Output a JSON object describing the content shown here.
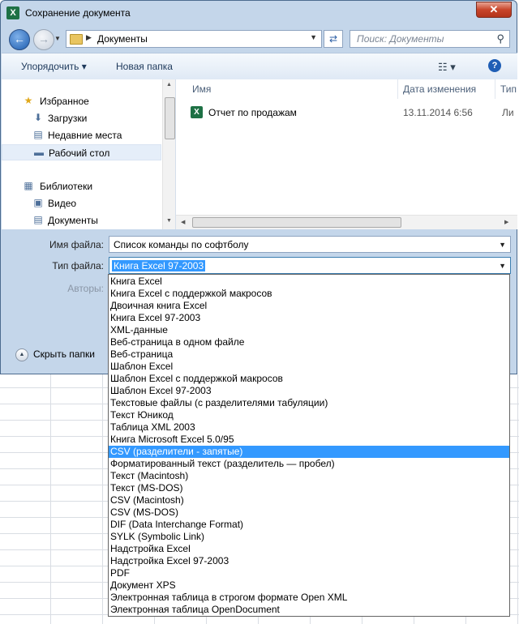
{
  "window": {
    "title": "Сохранение документа",
    "close_glyph": "✕",
    "app_icon": "excel-icon"
  },
  "nav": {
    "back_glyph": "←",
    "forward_glyph": "→",
    "path": "Документы",
    "search_placeholder": "Поиск: Документы"
  },
  "toolbar": {
    "organize": "Упорядочить ▾",
    "new_folder": "Новая папка",
    "help": "?"
  },
  "navpane": {
    "items": [
      {
        "label": "Избранное",
        "icon": "star-icon",
        "glyph": "★",
        "indent": 0
      },
      {
        "label": "Загрузки",
        "icon": "downloads-folder-icon",
        "glyph": "⬇",
        "indent": 1
      },
      {
        "label": "Недавние места",
        "icon": "recent-places-icon",
        "glyph": "▤",
        "indent": 1
      },
      {
        "label": "Рабочий стол",
        "icon": "desktop-icon",
        "glyph": "▬",
        "indent": 1,
        "selected": true
      },
      {
        "label": "Библиотеки",
        "icon": "libraries-icon",
        "glyph": "▦",
        "indent": 0
      },
      {
        "label": "Видео",
        "icon": "video-icon",
        "glyph": "▣",
        "indent": 1
      },
      {
        "label": "Документы",
        "icon": "documents-icon",
        "glyph": "▤",
        "indent": 1
      }
    ]
  },
  "filelist": {
    "columns": [
      "Имя",
      "Дата изменения",
      "Тип"
    ],
    "files": [
      {
        "name": "Отчет по продажам",
        "date": "13.11.2014 6:56",
        "type": "Ли"
      }
    ]
  },
  "form": {
    "filename_label": "Имя файла:",
    "filename_value": "Список команды по софтболу",
    "filetype_label": "Тип файла:",
    "filetype_value": "Книга Excel 97-2003",
    "authors_label": "Авторы:",
    "hide_folders": "Скрыть папки"
  },
  "dropdown": {
    "highlighted_index": 14,
    "options": [
      "Книга Excel",
      "Книга Excel с поддержкой макросов",
      "Двоичная книга Excel",
      "Книга Excel 97-2003",
      "XML-данные",
      "Веб-страница в одном файле",
      "Веб-страница",
      "Шаблон Excel",
      "Шаблон Excel с поддержкой макросов",
      "Шаблон Excel 97-2003",
      "Текстовые файлы (с разделителями табуляции)",
      "Текст Юникод",
      "Таблица XML 2003",
      "Книга Microsoft Excel 5.0/95",
      "CSV (разделители - запятые)",
      "Форматированный текст (разделитель — пробел)",
      "Текст (Macintosh)",
      "Текст (MS-DOS)",
      "CSV (Macintosh)",
      "CSV (MS-DOS)",
      "DIF (Data Interchange Format)",
      "SYLK (Symbolic Link)",
      "Надстройка Excel",
      "Надстройка Excel 97-2003",
      "PDF",
      "Документ XPS",
      "Электронная таблица в строгом формате Open XML",
      "Электронная таблица OpenDocument"
    ]
  }
}
